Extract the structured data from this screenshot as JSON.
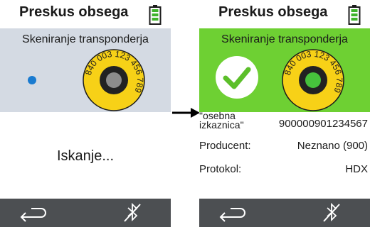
{
  "left_screen": {
    "title": "Preskus obsega",
    "scan_title": "Skeniranje transponderja",
    "tag_text": "840 003 123 456 789",
    "status": "Iskanje..."
  },
  "right_screen": {
    "title": "Preskus obsega",
    "scan_title": "Skeniranje transponderja",
    "tag_text": "840 003 123 456 789",
    "id_label": "\"osebna izkaznica\"",
    "id_value": "900000901234567",
    "producer_label": "Producent:",
    "producer_value": "Neznano (900)",
    "protocol_label": "Protokol:",
    "protocol_value": "HDX"
  },
  "icons": {
    "battery": "battery-full-icon",
    "back": "back-arrow-icon",
    "no_bluetooth": "bluetooth-off-icon",
    "check": "checkmark-icon",
    "transition_arrow": "arrow-right-icon"
  },
  "colors": {
    "scan_panel_searching": "#d4dae3",
    "scan_panel_success": "#6ed033",
    "tag_yellow": "#f7d117",
    "status_dot": "#1a7bd0",
    "bottom_bar": "#4c4f52",
    "battery_green": "#3fb32a"
  }
}
